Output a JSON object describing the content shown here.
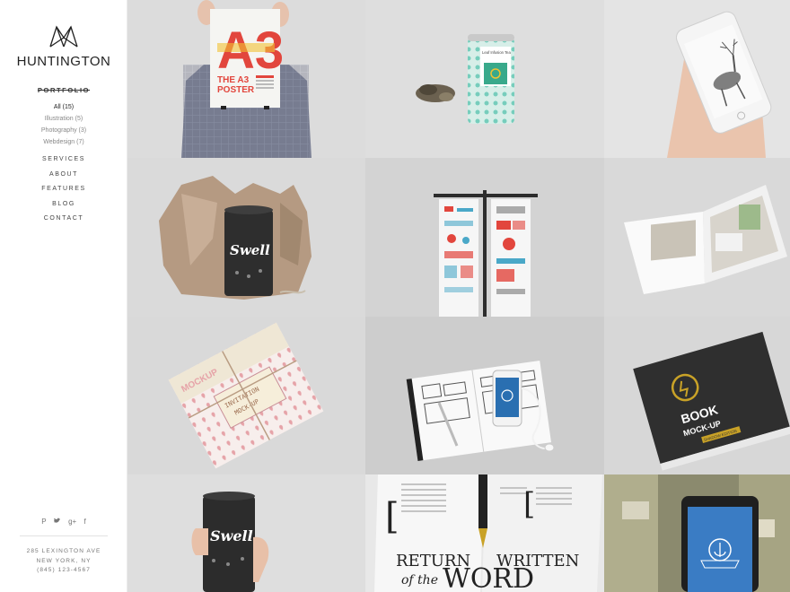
{
  "brand": {
    "name": "HUNTINGTON",
    "logo_icon": "mountain-lines-icon"
  },
  "nav": {
    "portfolio_label": "PORTFOLIO",
    "filters": [
      {
        "label": "All (15)",
        "active": true
      },
      {
        "label": "Illustration (5)",
        "active": false
      },
      {
        "label": "Photography (3)",
        "active": false
      },
      {
        "label": "Webdesign (7)",
        "active": false
      }
    ],
    "items": [
      "SERVICES",
      "ABOUT",
      "FEATURES",
      "BLOG",
      "CONTACT"
    ]
  },
  "social": [
    {
      "icon": "pinterest-icon",
      "glyph": "P"
    },
    {
      "icon": "twitter-icon",
      "glyph": "♥"
    },
    {
      "icon": "google-plus-icon",
      "glyph": "g+"
    },
    {
      "icon": "facebook-icon",
      "glyph": "f"
    }
  ],
  "address": [
    "285 LEXINGTON AVE",
    "NEW YORK, NY",
    "(845) 123-4567"
  ],
  "tiles": {
    "poster_big_letters": "A3",
    "poster_heading_1": "THE A3",
    "poster_heading_2": "POSTER",
    "tea_label": "Leaf Infusion Tea",
    "swell_brand": "Swell",
    "mockup_tag": "MOCKUP",
    "invitation_text_1": "INVITATION",
    "invitation_text_2": "MOCK-UP",
    "book_title_1": "BOOK",
    "book_title_2": "MOCK-UP",
    "book_badge": "SHADOW EDITION",
    "magazine_words_1": "RETURN",
    "magazine_words_2": "of the",
    "magazine_words_3": "WRITTEN",
    "magazine_words_4": "WORD",
    "colors": {
      "tile_bg": "#d9d9d9",
      "poster_red": "#e2463d",
      "poster_yellow": "#f1c232",
      "tea_teal": "#4dbfaa",
      "book_dark": "#333333",
      "gold": "#c9a227"
    }
  }
}
